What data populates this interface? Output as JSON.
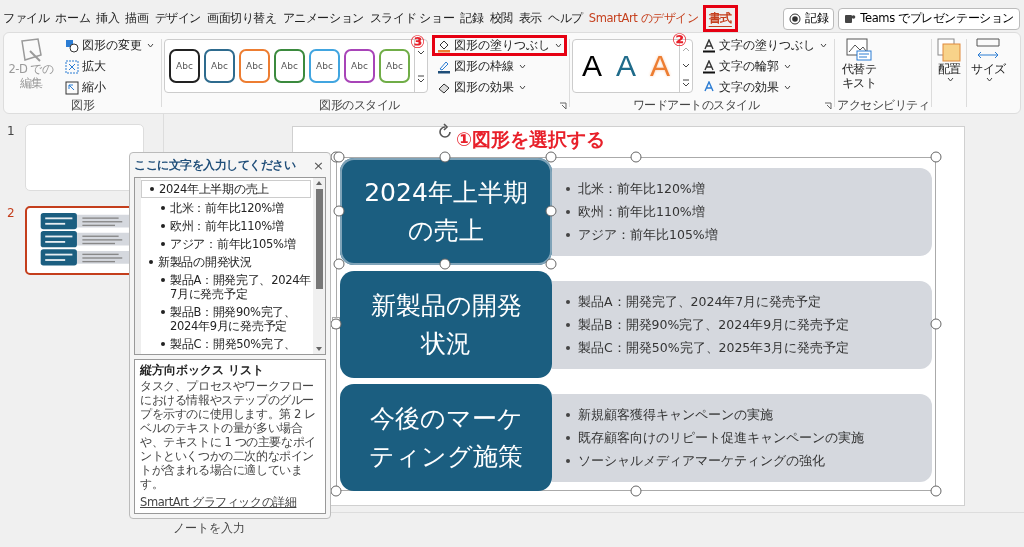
{
  "tabs": [
    {
      "label": "ファイル",
      "selected": false,
      "kind": "normal",
      "highlighted": false
    },
    {
      "label": "ホーム",
      "selected": false,
      "kind": "normal",
      "highlighted": false
    },
    {
      "label": "挿入",
      "selected": false,
      "kind": "normal",
      "highlighted": false
    },
    {
      "label": "描画",
      "selected": false,
      "kind": "normal",
      "highlighted": false
    },
    {
      "label": "デザイン",
      "selected": false,
      "kind": "normal",
      "highlighted": false
    },
    {
      "label": "画面切り替え",
      "selected": false,
      "kind": "normal",
      "highlighted": false
    },
    {
      "label": "アニメーション",
      "selected": false,
      "kind": "normal",
      "highlighted": false
    },
    {
      "label": "スライド ショー",
      "selected": false,
      "kind": "normal",
      "highlighted": false
    },
    {
      "label": "記録",
      "selected": false,
      "kind": "normal",
      "highlighted": false
    },
    {
      "label": "校閲",
      "selected": false,
      "kind": "normal",
      "highlighted": false
    },
    {
      "label": "表示",
      "selected": false,
      "kind": "normal",
      "highlighted": false
    },
    {
      "label": "ヘルプ",
      "selected": false,
      "kind": "normal",
      "highlighted": false
    },
    {
      "label": "SmartArt のデザイン",
      "selected": false,
      "kind": "contextual",
      "highlighted": false
    },
    {
      "label": "書式",
      "selected": true,
      "kind": "contextual",
      "highlighted": true
    }
  ],
  "record_button": "記録",
  "teams_button": "Teams でプレゼンテーション",
  "ribbon": {
    "shapes": {
      "label": "図形",
      "edit_2d": {
        "label": "2-D での編集",
        "disabled": true
      },
      "buttons": [
        {
          "label": "図形の変更",
          "dropdown": true
        },
        {
          "label": "拡大",
          "dropdown": false
        },
        {
          "label": "縮小",
          "dropdown": false
        }
      ]
    },
    "shape_styles": {
      "label": "図形のスタイル",
      "swatches": [
        {
          "text": "Abc",
          "color": "#222222"
        },
        {
          "text": "Abc",
          "color": "#2e6b8e"
        },
        {
          "text": "Abc",
          "color": "#ed7d31"
        },
        {
          "text": "Abc",
          "color": "#3b8a3e"
        },
        {
          "text": "Abc",
          "color": "#41a5e0"
        },
        {
          "text": "Abc",
          "color": "#a844b8"
        },
        {
          "text": "Abc",
          "color": "#70ad47"
        }
      ]
    },
    "shape_format": [
      {
        "label": "図形の塗りつぶし",
        "highlighted": true
      },
      {
        "label": "図形の枠線",
        "highlighted": false
      },
      {
        "label": "図形の効果",
        "highlighted": false
      }
    ],
    "wordart": {
      "label": "ワードアートのスタイル",
      "samples": [
        {
          "text": "A",
          "color": "#000000",
          "kind": "solid"
        },
        {
          "text": "A",
          "color": "#1f6b8a",
          "kind": "solid"
        },
        {
          "text": "A",
          "color": "#ed7d31",
          "kind": "outline"
        }
      ],
      "buttons": [
        "文字の塗りつぶし",
        "文字の輪郭",
        "文字の効果"
      ]
    },
    "accessibility": {
      "label": "アクセシビリティ",
      "alt_text": "代替テキスト"
    },
    "arrange": "配置",
    "size": "サイズ"
  },
  "slides": [
    {
      "number": "1",
      "selected": false,
      "kind": "blank"
    },
    {
      "number": "2",
      "selected": true,
      "kind": "smartart"
    }
  ],
  "text_pane": {
    "title": "ここに文字を入力してください",
    "close": "×",
    "items": [
      {
        "text": "2024年上半期の売上",
        "selected": true,
        "children": [
          {
            "text": "北米：前年比120%増",
            "selected": false
          },
          {
            "text": "欧州：前年比110%増",
            "selected": false
          },
          {
            "text": "アジア：前年比105%増",
            "selected": false
          }
        ]
      },
      {
        "text": "新製品の開発状況",
        "selected": false,
        "children": [
          {
            "text": "製品A：開発完了、2024年7月に発売予定",
            "selected": false
          },
          {
            "text": "製品B：開発90%完了、2024年9月に発売予定",
            "selected": false
          },
          {
            "text": "製品C：開発50%完了、",
            "selected": false
          }
        ]
      }
    ],
    "description": {
      "title": "縦方向ボックス リスト",
      "text": "タスク、プロセスやワークフローにおける情報やステップのグループを示すのに使用します。第 2 レベルのテキストの量が多い場合や、テキストに 1 つの主要なポイントといくつかの二次的なポイントが含まれる場合に適しています。",
      "link": "SmartArt グラフィックの詳細"
    }
  },
  "smartart": {
    "rows": [
      {
        "heading": [
          "2024年上半期",
          "の売上"
        ],
        "selected": true,
        "bullets": [
          "北米：前年比120%増",
          "欧州：前年比110%増",
          "アジア：前年比105%増"
        ]
      },
      {
        "heading": [
          "新製品の開発",
          "状況"
        ],
        "selected": false,
        "bullets": [
          "製品A：開発完了、2024年7月に発売予定",
          "製品B：開発90%完了、2024年9月に発売予定",
          "製品C：開発50%完了、2025年3月に発売予定"
        ]
      },
      {
        "heading": [
          "今後のマーケ",
          "ティング施策"
        ],
        "selected": false,
        "bullets": [
          "新規顧客獲得キャンペーンの実施",
          "既存顧客向けのリピート促進キャンペーンの実施",
          "ソーシャルメディアマーケティングの強化"
        ]
      }
    ]
  },
  "annotations": {
    "instruction": "①図形を選択する",
    "step2": "②",
    "step3": "③"
  },
  "notes_placeholder": "ノートを入力"
}
